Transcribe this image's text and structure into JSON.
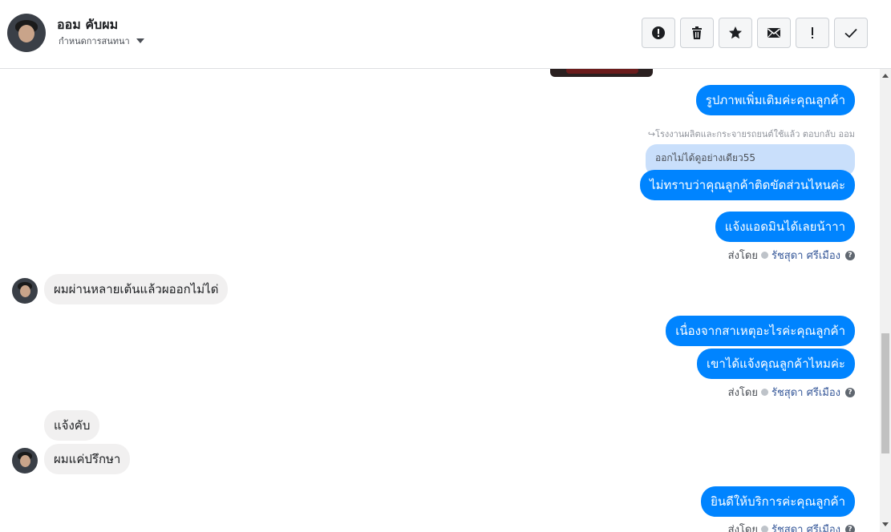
{
  "header": {
    "contact_name": "ออม คับผม",
    "subtitle": "กำหนดการสนทนา",
    "toolbar": [
      {
        "icon": "alert-circle-icon",
        "name": "spam-button"
      },
      {
        "icon": "trash-icon",
        "name": "delete-button"
      },
      {
        "icon": "star-icon",
        "name": "star-button"
      },
      {
        "icon": "envelope-icon",
        "name": "mark-unread-button"
      },
      {
        "icon": "exclamation-icon",
        "name": "follow-up-button"
      },
      {
        "icon": "check-icon",
        "name": "mark-done-button"
      }
    ]
  },
  "messages": {
    "m1": "รูปภาพเพิ่มเติมค่ะคุณลูกค้า",
    "reply_note": "↪โรงงานผลิตและกระจายรถยนต์ใช้แล้ว ตอบกลับ ออม",
    "reply_quote": "ออกไม่ได้ดูอย่างเดียว55",
    "m2": "ไม่ทราบว่าคุณลูกค้าติดขัดส่วนไหนค่ะ",
    "m3": "แจ้งแอดมินได้เลยน้าาา",
    "m4": "ผมผ่านหลายเต้นแล้วผออกไม่ได่",
    "m5": "เนื่องจากสาเหตุอะไรค่ะคุณลูกค้า",
    "m6": "เขาได้แจ้งคุณลูกค้าไหมค่ะ",
    "m7": "แจ้งคับ",
    "m8": "ผมแค่ปรึกษา",
    "m9": "ยินดีให้บริการค่ะคุณลูกค้า"
  },
  "sent_by": {
    "label": "ส่งโดย",
    "agent": "รัชสุดา ศรีเมือง"
  },
  "colors": {
    "outgoing_bubble": "#0084ff",
    "incoming_bubble": "#f1f0f0",
    "reply_quote": "#c9dffb"
  }
}
